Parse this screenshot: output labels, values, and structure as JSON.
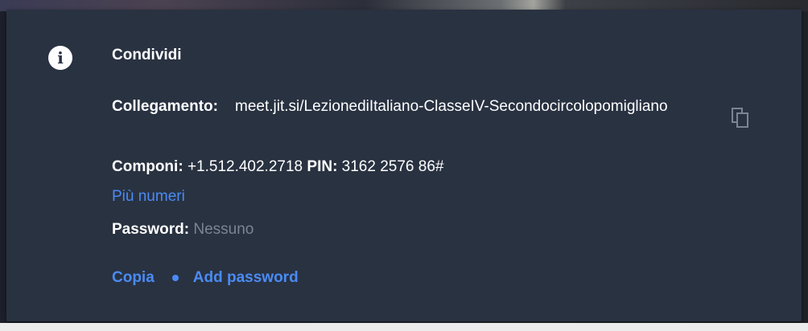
{
  "dialog": {
    "title": "Condividi",
    "link_label": "Collegamento:",
    "link_value": "meet.jit.si/LezionediItaliano-ClasseIV-Secondocircolopomigliano",
    "dial_label": "Componi:",
    "dial_number": "+1.512.402.2718",
    "pin_label": "PIN:",
    "pin_value": "3162 2576 86#",
    "more_numbers": "Più numeri",
    "password_label": "Password:",
    "password_value": "Nessuno",
    "copy_label": "Copia",
    "add_password_label": "Add password"
  },
  "icons": {
    "info": "info-icon",
    "copy": "copy-icon"
  },
  "colors": {
    "dialog_bg": "#293241",
    "link_blue": "#4a8bf5",
    "muted_text": "#7a8594",
    "text": "#ffffff"
  }
}
